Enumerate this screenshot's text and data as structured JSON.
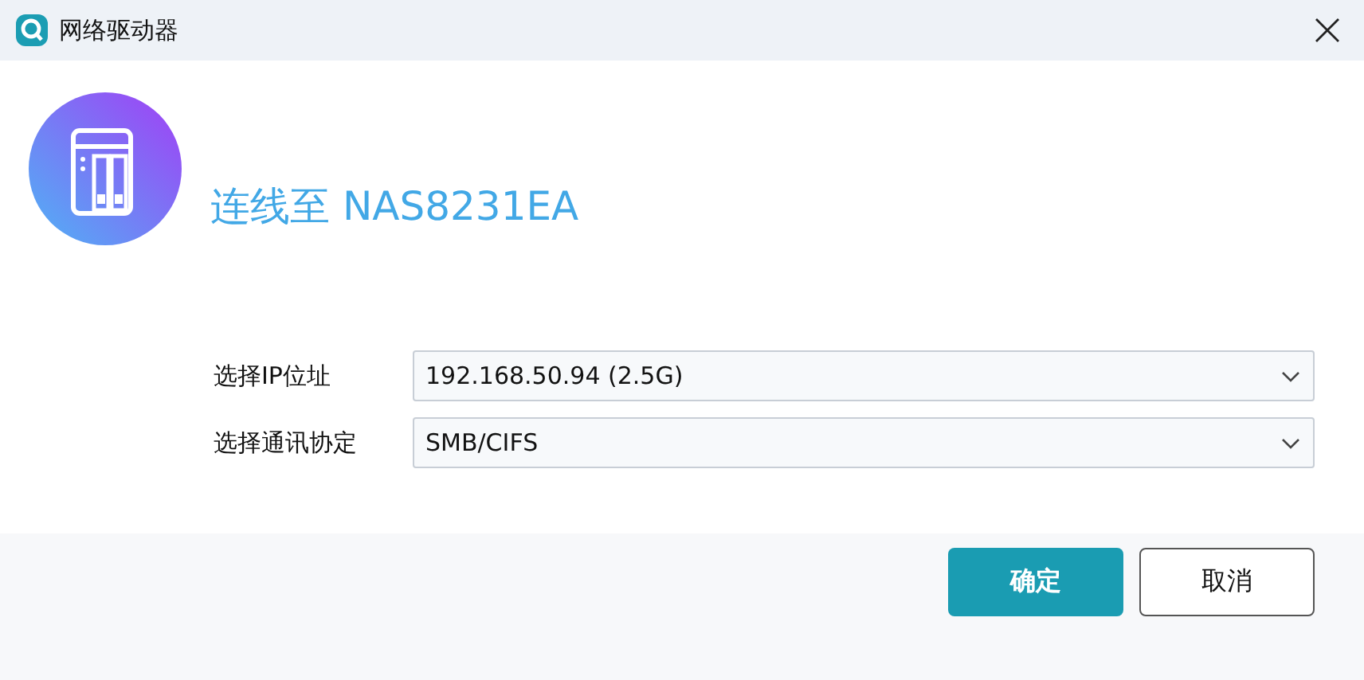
{
  "window": {
    "title": "网络驱动器"
  },
  "heading": "连线至 NAS8231EA",
  "fields": [
    {
      "label": "选择IP位址",
      "value": "192.168.50.94 (2.5G)"
    },
    {
      "label": "选择通讯协定",
      "value": "SMB/CIFS"
    }
  ],
  "buttons": [
    {
      "label": "确定",
      "kind": "primary"
    },
    {
      "label": "取消",
      "kind": "secondary"
    }
  ]
}
